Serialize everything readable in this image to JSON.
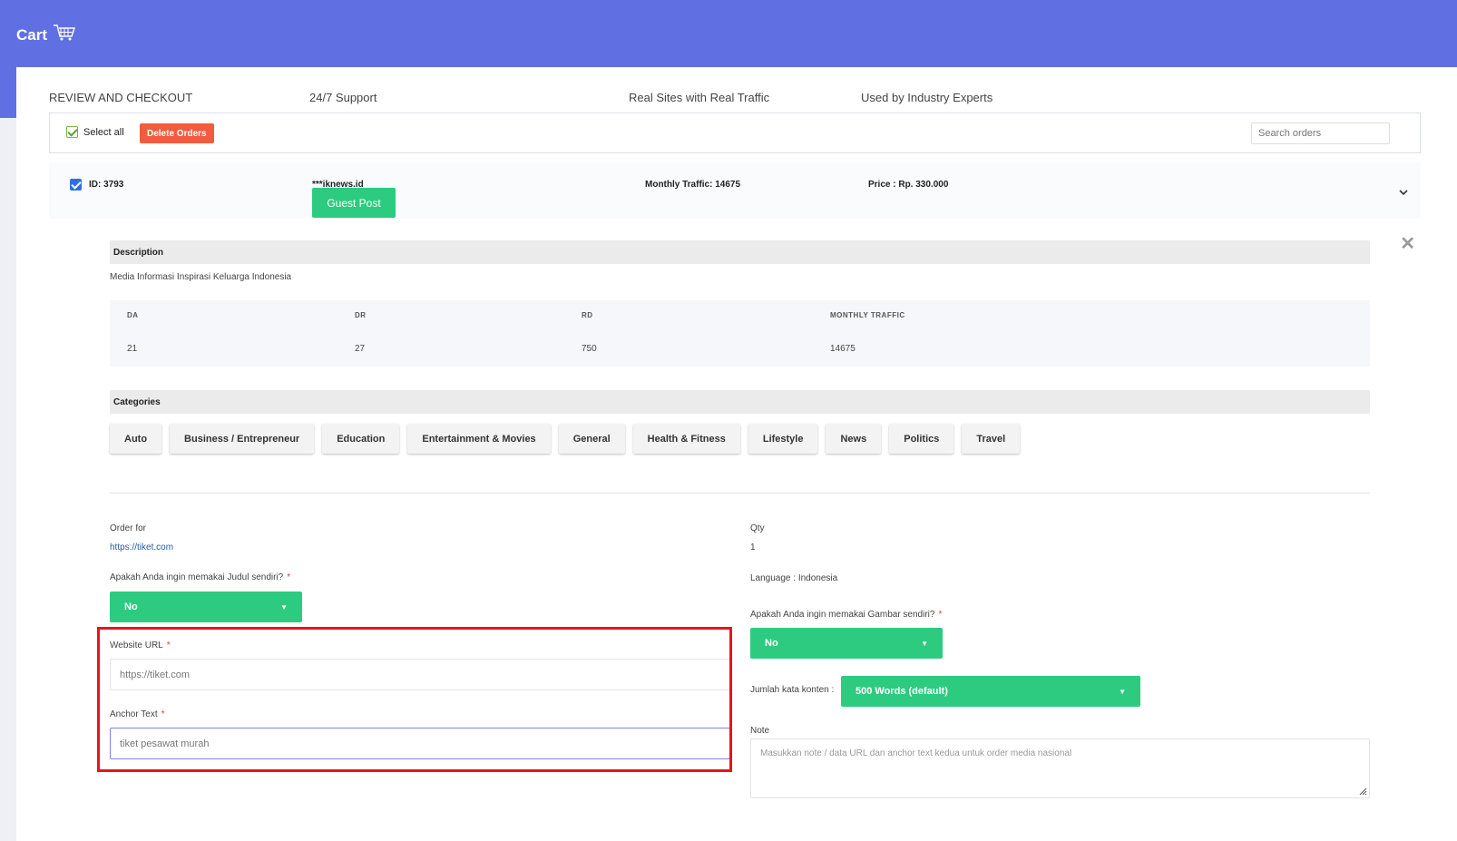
{
  "header": {
    "title": "Cart"
  },
  "topnav": {
    "review": "REVIEW AND CHECKOUT",
    "support": "24/7 Support",
    "real_sites": "Real Sites with Real Traffic",
    "experts": "Used by Industry Experts"
  },
  "toolbar": {
    "select_all": "Select all",
    "delete_orders": "Delete Orders",
    "search_placeholder": "Search orders"
  },
  "order": {
    "id": "ID: 3793",
    "site": "***iknews.id",
    "traffic": "Monthly Traffic: 14675",
    "price": "Price : Rp. 330.000",
    "type_button": "Guest Post"
  },
  "description": {
    "title": "Description",
    "text": "Media Informasi Inspirasi Keluarga Indonesia"
  },
  "metrics": {
    "da_label": "DA",
    "dr_label": "DR",
    "rd_label": "RD",
    "mt_label": "MONTHLY TRAFFIC",
    "da": "21",
    "dr": "27",
    "rd": "750",
    "mt": "14675"
  },
  "categories": {
    "title": "Categories",
    "items": [
      "Auto",
      "Business / Entrepreneur",
      "Education",
      "Entertainment & Movies",
      "General",
      "Health & Fitness",
      "Lifestyle",
      "News",
      "Politics",
      "Travel"
    ]
  },
  "form": {
    "order_for_label": "Order for",
    "order_for_value": "https://tiket.com",
    "qty_label": "Qty",
    "qty_value": "1",
    "judul_label": "Apakah Anda ingin memakai Judul sendiri?",
    "judul_value": "No",
    "language": "Language : Indonesia",
    "gambar_label": "Apakah Anda ingin memakai Gambar sendiri?",
    "gambar_value": "No",
    "website_label": "Website URL",
    "website_value": "https://tiket.com",
    "anchor_label": "Anchor Text",
    "anchor_value": "tiket pesawat murah",
    "jumlah_label": "Jumlah kata konten :",
    "jumlah_value": "500 Words (default)",
    "note_label": "Note",
    "note_placeholder": "Masukkan note / data URL dan anchor text kedua untuk order media nasional",
    "required_mark": "*"
  },
  "colors": {
    "header": "#6070e2",
    "green": "#2dcb7f",
    "delete": "#f25c3e",
    "highlight": "#e8141c"
  }
}
